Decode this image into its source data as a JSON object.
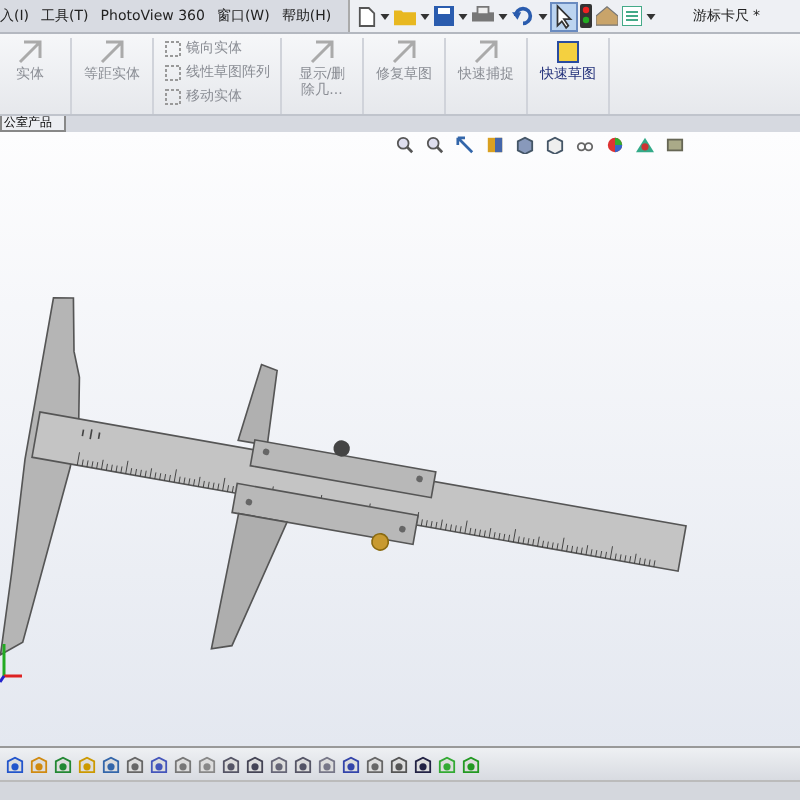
{
  "menu": [
    {
      "label": "入(I)"
    },
    {
      "label": "工具(T)"
    },
    {
      "label": "PhotoView 360"
    },
    {
      "label": "窗口(W)"
    },
    {
      "label": "帮助(H)"
    }
  ],
  "document_title": "游标卡尺 *",
  "ribbon": [
    {
      "kind": "large",
      "label": "实体",
      "disabled": true
    },
    {
      "kind": "large",
      "label": "等距实体",
      "disabled": true
    },
    {
      "kind": "stack",
      "items": [
        {
          "label": "镜向实体",
          "disabled": true
        },
        {
          "label": "线性草图阵列",
          "disabled": true
        },
        {
          "label": "移动实体",
          "disabled": true
        }
      ]
    },
    {
      "kind": "large",
      "label": "显示/删除几...",
      "disabled": true
    },
    {
      "kind": "large",
      "label": "修复草图",
      "disabled": true
    },
    {
      "kind": "large",
      "label": "快速捕捉",
      "disabled": true
    },
    {
      "kind": "large",
      "label": "快速草图",
      "disabled": false
    }
  ],
  "tab": {
    "label": "公室产品"
  }
}
